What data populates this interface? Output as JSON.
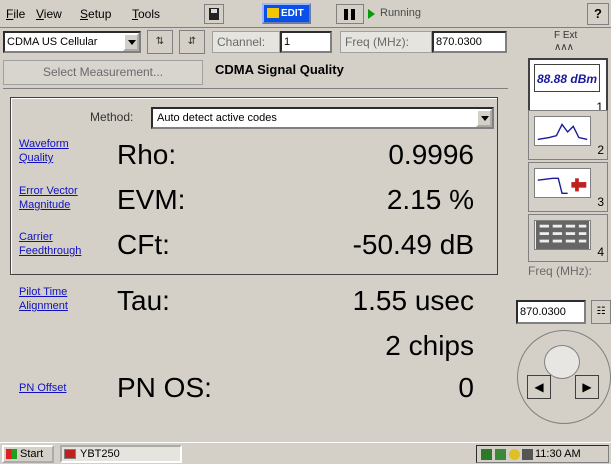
{
  "menu": {
    "file": "File",
    "view": "View",
    "setup": "Setup",
    "tools": "Tools"
  },
  "toolbar": {
    "edit_label": "EDIT",
    "status": "Running",
    "help": "?"
  },
  "controls": {
    "standard": "CDMA US Cellular",
    "channel_label": "Channel:",
    "channel_value": "1",
    "freq_label": "Freq (MHz):",
    "freq_value": "870.0300",
    "ext_label": "F Ext",
    "ext_wave": "∧∧∧"
  },
  "measurement": {
    "select_button": "Select Measurement...",
    "title": "CDMA Signal Quality"
  },
  "method": {
    "label": "Method:",
    "value": "Auto detect active codes"
  },
  "readings": [
    {
      "link": [
        "Waveform",
        "Quality"
      ],
      "label": "Rho:",
      "value": "0.9996"
    },
    {
      "link": [
        "Error Vector",
        "Magnitude"
      ],
      "label": "EVM:",
      "value": "2.15 %"
    },
    {
      "link": [
        "Carrier",
        "Feedthrough"
      ],
      "label": "CFt:",
      "value": "-50.49 dB"
    },
    {
      "link": [
        "Pilot Time",
        "Alignment"
      ],
      "label": "Tau:",
      "value": "1.55 usec",
      "value2": "2 chips"
    },
    {
      "link": [
        "PN Offset"
      ],
      "label": "PN OS:",
      "value": "0"
    }
  ],
  "side": {
    "btn1_text": "88.88 dBm",
    "btn1_num": "1",
    "btn2_num": "2",
    "btn3_num": "3",
    "btn4_num": "4",
    "freq_label": "Freq (MHz):",
    "freq_value": "870.0300",
    "keypad": "☷"
  },
  "taskbar": {
    "start": "Start",
    "task": "YBT250",
    "time": "11:30 AM"
  },
  "colors": {
    "link": "#1010c0",
    "edit_bg": "#0a50e6",
    "run_icon": "#0a9a0a"
  }
}
